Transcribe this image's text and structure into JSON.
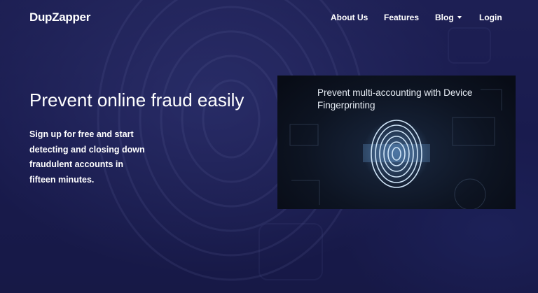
{
  "brand": {
    "name": "DupZapper"
  },
  "nav": {
    "about": "About Us",
    "features": "Features",
    "blog": "Blog",
    "login": "Login"
  },
  "hero": {
    "headline": "Prevent online fraud easily",
    "subtext": "Sign up for free and start detecting and closing down fraudulent accounts in fifteen minutes."
  },
  "video": {
    "caption": "Prevent multi-accounting with Device Fingerprinting"
  },
  "colors": {
    "background": "#1c1f52",
    "text": "#ffffff",
    "video_bg": "#0d1422",
    "fingerprint_glow": "#7fb6e6"
  }
}
